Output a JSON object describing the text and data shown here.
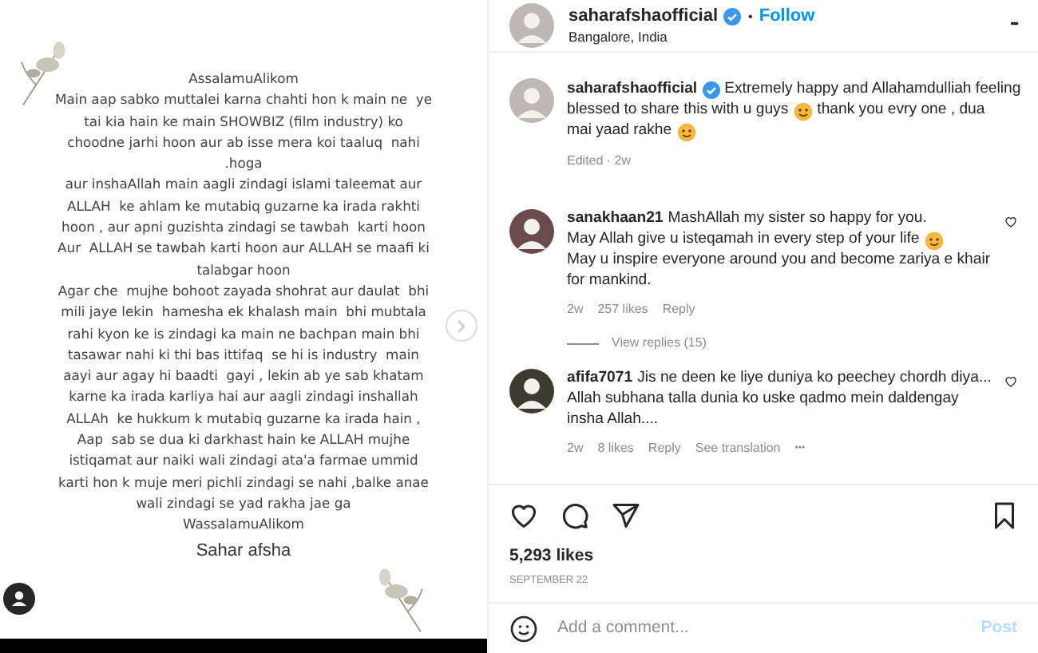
{
  "post_image": {
    "lines": [
      "AssalamuAlikom",
      "Main aap sabko muttalei karna chahti hon k main ne  ye",
      "tai kia hain ke main SHOWBIZ (film industry) ko",
      "choodne jarhi hoon aur ab isse mera koi taaluq  nahi",
      ".hoga",
      "aur inshaAllah main aagli zindagi islami taleemat aur",
      "ALLAH  ke ahlam ke mutabiq guzarne ka irada rakhti",
      "hoon , aur apni guzishta zindagi se tawbah  karti hoon",
      "Aur  ALLAH se tawbah karti hoon aur ALLAH se maafi ki",
      "talabgar hoon",
      "Agar che  mujhe bohoot zayada shohrat aur daulat  bhi",
      "mili jaye lekin  hamesha ek khalash main  bhi mubtala",
      "rahi kyon ke is zindagi ka main ne bachpan main bhi",
      "tasawar nahi ki thi bas ittifaq  se hi is industry  main",
      "aayi aur agay hi baadti  gayi , lekin ab ye sab khatam",
      "karne ka irada karliya hai aur aagli zindagi inshallah",
      "ALLAh  ke hukkum k mutabiq guzarne ka irada hain ,",
      "Aap  sab se dua ki darkhast hain ke ALLAH mujhe",
      "istiqamat aur naiki wali zindagi ata'a farmae ummid",
      "karti hon k muje meri pichli zindagi se nahi ,balke anae",
      "wali zindagi se yad rakha jae ga",
      "WassalamuAlikom"
    ],
    "signature": "Sahar afsha"
  },
  "header": {
    "username": "saharafshaofficial",
    "verified": true,
    "separator": "•",
    "follow": "Follow",
    "location": "Bangalore, India",
    "more": "•••"
  },
  "caption": {
    "username": "saharafshaofficial",
    "verified": true,
    "lines": [
      [
        {
          "kind": "text",
          "text": "Extremely happy and Allahamdulliah feeling"
        }
      ],
      [
        {
          "kind": "text",
          "text": "blessed to share this with u guys"
        },
        {
          "kind": "emoji"
        },
        {
          "kind": "text",
          "text": "thank you evry one , dua"
        }
      ],
      [
        {
          "kind": "text",
          "text": "mai yaad rakhe"
        },
        {
          "kind": "emoji"
        }
      ]
    ],
    "meta": "Edited · 2w"
  },
  "comments": [
    {
      "username": "sanakhaan21",
      "lines": [
        [
          {
            "kind": "text",
            "text": "MashAllah my sister so happy for you."
          }
        ],
        [
          {
            "kind": "text",
            "text": "May Allah give u isteqamah in every step of your life"
          },
          {
            "kind": "emoji"
          }
        ],
        [
          {
            "kind": "text",
            "text": "May u inspire everyone around you and become zariya e khair"
          }
        ],
        [
          {
            "kind": "text",
            "text": "for mankind."
          }
        ]
      ],
      "time": "2w",
      "likes": "257 likes",
      "reply": "Reply",
      "view_replies": "View replies (15)"
    },
    {
      "username": "afifa7071",
      "lines": [
        [
          {
            "kind": "text",
            "text": "Jis ne deen ke liye duniya ko peechey chordh diya..."
          }
        ],
        [
          {
            "kind": "text",
            "text": "Allah subhana talla dunia ko uske qadmo mein daldengay"
          }
        ],
        [
          {
            "kind": "text",
            "text": "insha Allah...."
          }
        ]
      ],
      "time": "2w",
      "likes": "8 likes",
      "reply": "Reply",
      "translation": "See translation",
      "more": "•••"
    }
  ],
  "likes": "5,293 likes",
  "date": "SEPTEMBER 22",
  "comment_box": {
    "placeholder": "Add a comment...",
    "post": "Post"
  }
}
